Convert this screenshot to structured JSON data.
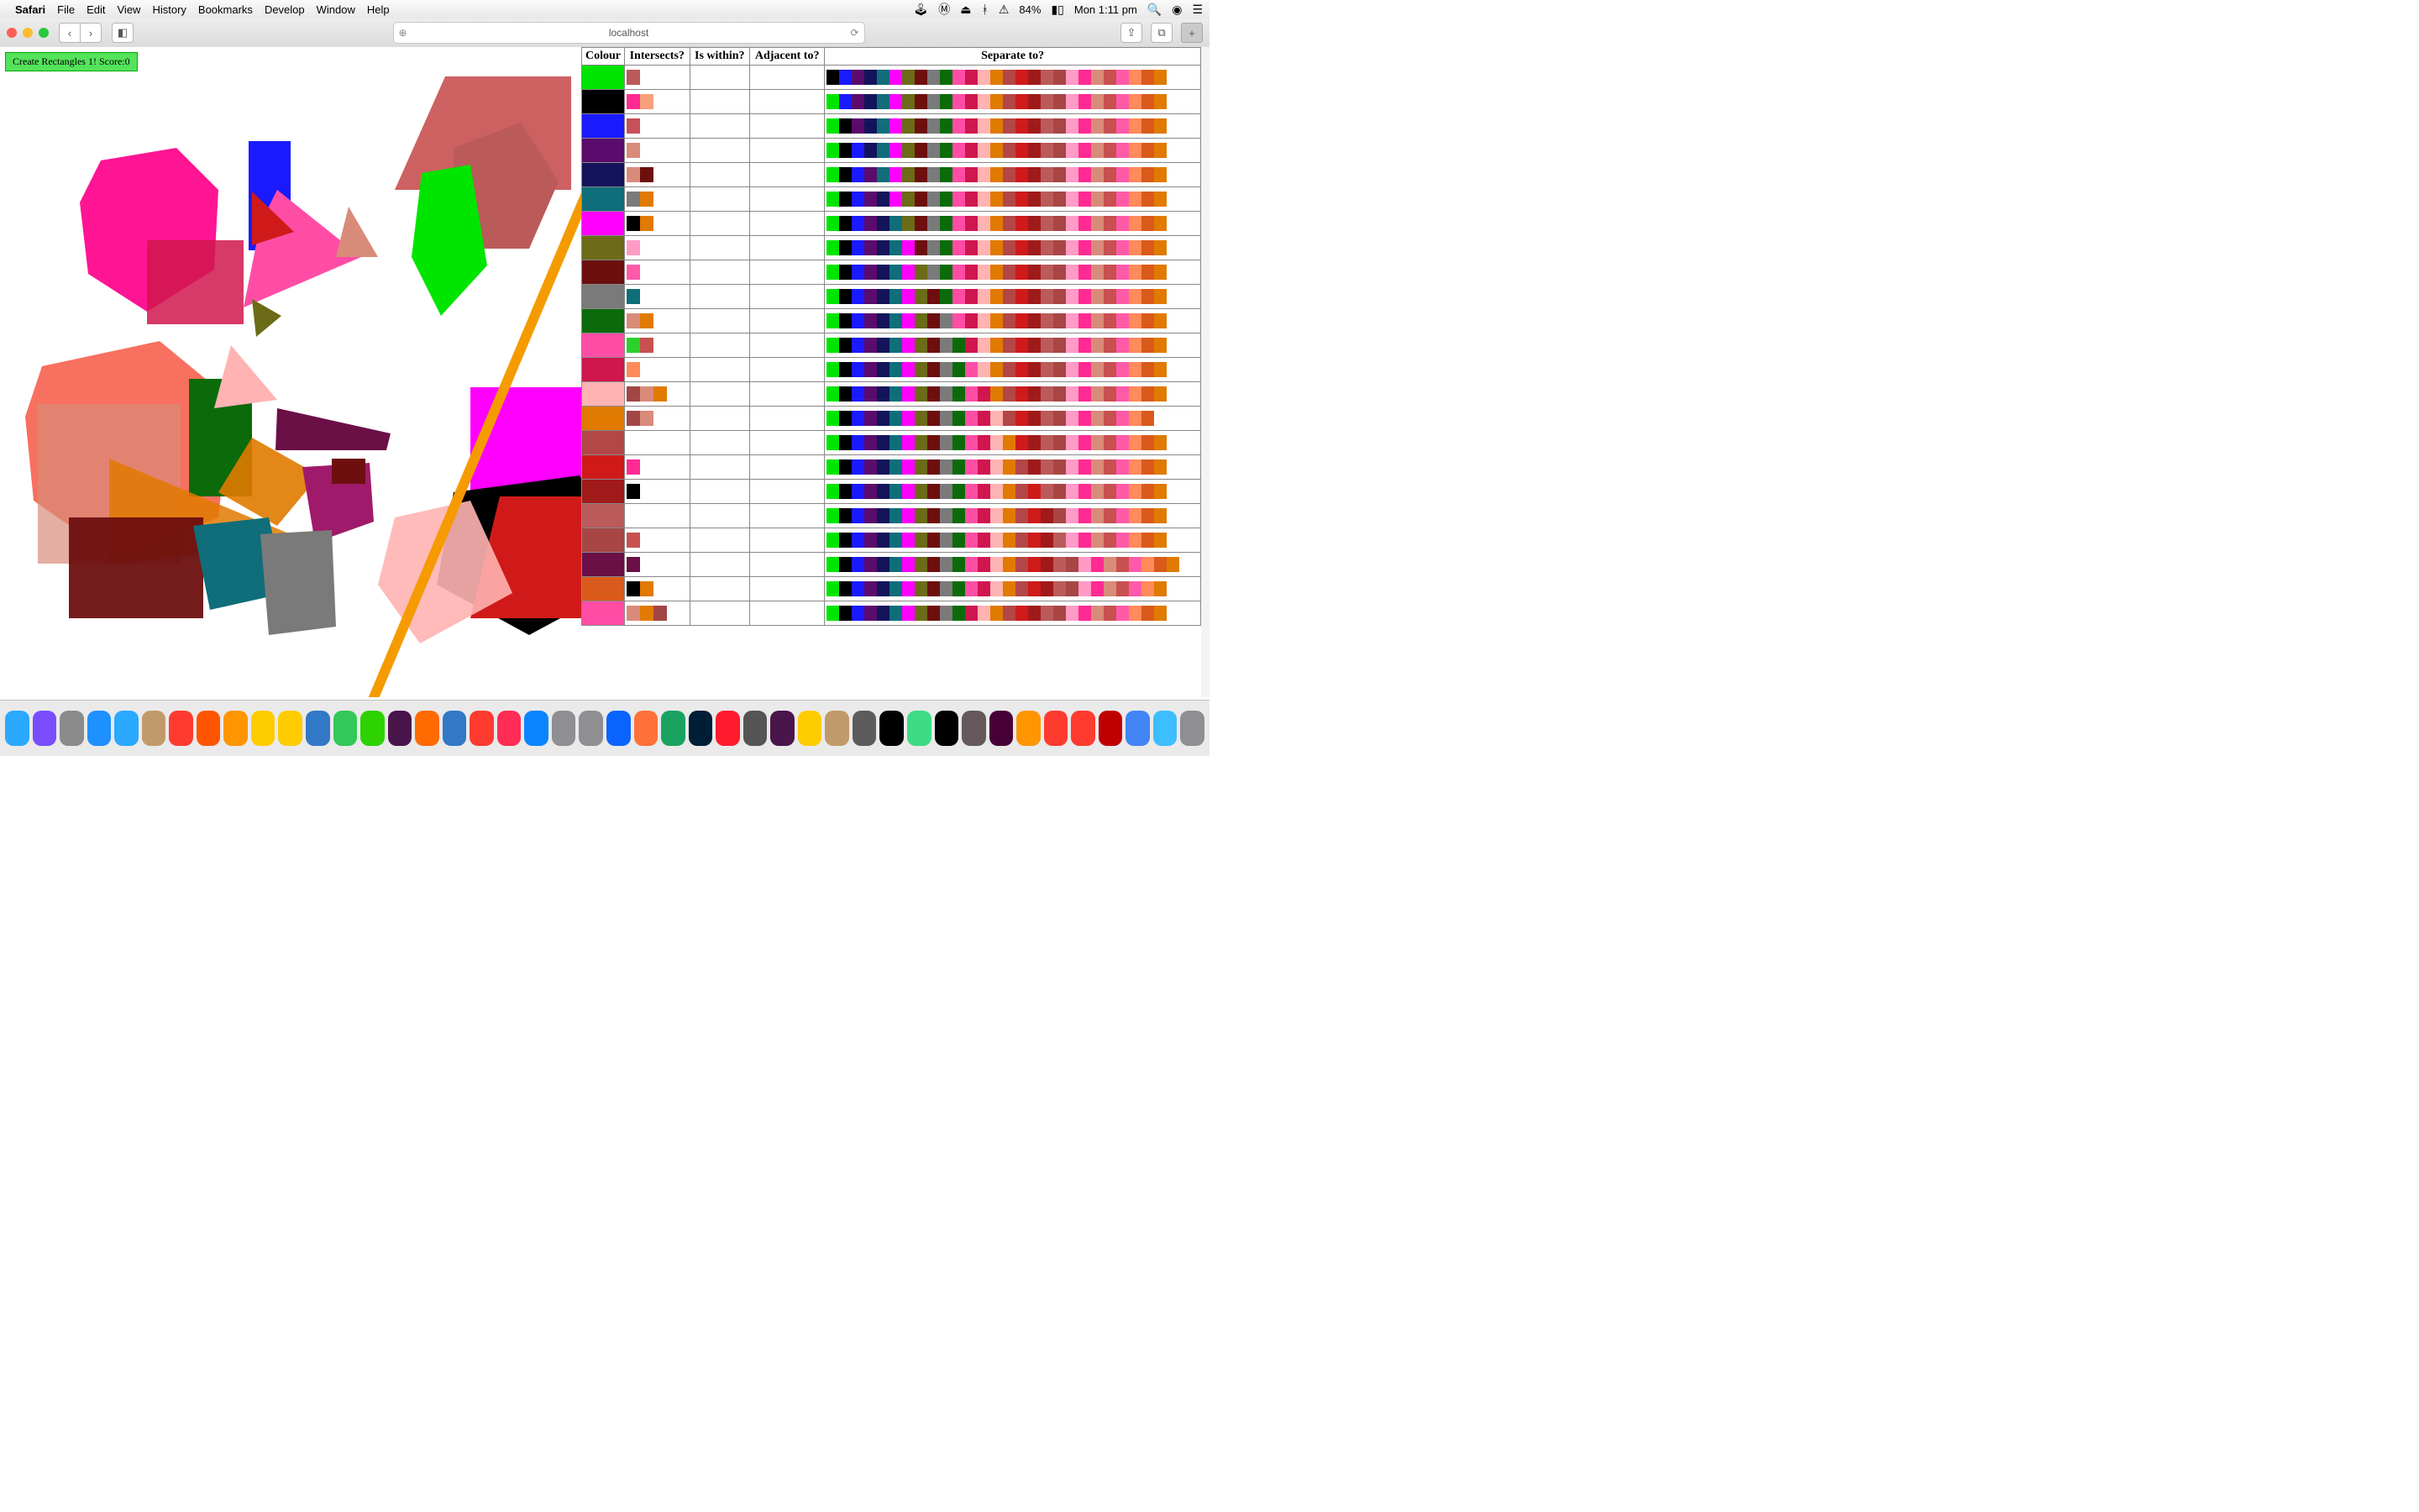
{
  "menubar": {
    "app": "Safari",
    "items": [
      "File",
      "Edit",
      "View",
      "History",
      "Bookmarks",
      "Develop",
      "Window",
      "Help"
    ],
    "battery_pct": "84%",
    "clock": "Mon 1:11 pm"
  },
  "toolbar": {
    "url": "localhost"
  },
  "page": {
    "score_button": "Create Rectangles 1! Score:0",
    "headers": {
      "colour": "Colour",
      "intersects": "Intersects?",
      "within": "Is within?",
      "adjacent": "Adjacent to?",
      "separate": "Separate to?"
    },
    "rows": [
      {
        "colour": "#00e500",
        "intersects": [
          "#bb5a5a"
        ]
      },
      {
        "colour": "#000000",
        "intersects": [
          "#ff2a92",
          "#f7a07a"
        ]
      },
      {
        "colour": "#1a1aff",
        "intersects": [
          "#c8505a"
        ]
      },
      {
        "colour": "#5b0b6b",
        "intersects": [
          "#d98b7a"
        ]
      },
      {
        "colour": "#14145c",
        "intersects": [
          "#d98b7a",
          "#6d0f0f"
        ]
      },
      {
        "colour": "#0f6e7a",
        "intersects": [
          "#7a7a7a",
          "#e07a00"
        ]
      },
      {
        "colour": "#ff00ff",
        "intersects": [
          "#000000",
          "#e07a00"
        ]
      },
      {
        "colour": "#6b6b18",
        "intersects": [
          "#ff9bc5"
        ]
      },
      {
        "colour": "#6d0f0f",
        "intersects": [
          "#ff5aa8"
        ]
      },
      {
        "colour": "#7a7a7a",
        "intersects": [
          "#0f6e7a"
        ]
      },
      {
        "colour": "#0b6b0b",
        "intersects": [
          "#d98b7a",
          "#e07a00"
        ]
      },
      {
        "colour": "#ff4da6",
        "intersects": [
          "#2bd12b",
          "#c85050"
        ]
      },
      {
        "colour": "#d0164e",
        "intersects": [
          "#ff8a5a"
        ]
      },
      {
        "colour": "#ffb3b3",
        "intersects": [
          "#a34545",
          "#d98b7a",
          "#e07a00"
        ]
      },
      {
        "colour": "#e07a00",
        "intersects": [
          "#a34545",
          "#d98b7a"
        ]
      },
      {
        "colour": "#b34747",
        "intersects": []
      },
      {
        "colour": "#d01a1a",
        "intersects": [
          "#ff2a92"
        ]
      },
      {
        "colour": "#a01a1a",
        "intersects": [
          "#000000"
        ]
      },
      {
        "colour": "#bb5a5a",
        "intersects": []
      },
      {
        "colour": "#a84545",
        "intersects": [
          "#c85050"
        ]
      },
      {
        "colour": "#6b0f47",
        "intersects": [
          "#6b0f47"
        ]
      },
      {
        "colour": "#d95a1a",
        "intersects": [
          "#000000",
          "#e07a00"
        ]
      },
      {
        "colour": "#ff4da6",
        "intersects": [
          "#d98b7a",
          "#e07a00",
          "#a34545"
        ]
      }
    ],
    "separate_palette": [
      "#00e500",
      "#000000",
      "#1a1aff",
      "#5b0b6b",
      "#14145c",
      "#0f6e7a",
      "#ff00ff",
      "#6b6b18",
      "#6d0f0f",
      "#7a7a7a",
      "#0b6b0b",
      "#ff4da6",
      "#d0164e",
      "#ffb3b3",
      "#e07a00",
      "#b34747",
      "#d01a1a",
      "#a01a1a",
      "#bb5a5a",
      "#a84545",
      "#ff9bc5",
      "#ff2a92",
      "#d98b7a",
      "#c85050",
      "#ff5aa8",
      "#ff8a5a",
      "#d95a1a",
      "#e07a00"
    ]
  },
  "dock_icons": [
    "finder",
    "siri",
    "launchpad",
    "safari",
    "mail",
    "contacts",
    "calendar",
    "dictionary",
    "reminders",
    "photos",
    "notes",
    "preview",
    "messages",
    "wechat",
    "slack",
    "charts",
    "xcode",
    "no-entry",
    "itunes",
    "appstore",
    "systemprefs",
    "activity",
    "firefox-dev",
    "firefox",
    "chrome",
    "photoshop",
    "opera",
    "bitdefender",
    "slack2",
    "star",
    "palette",
    "gimp",
    "terminal",
    "android",
    "terminal2",
    "atom",
    "xd",
    "clock",
    "tag",
    "square",
    "filezilla",
    "translate",
    "folder",
    "trash"
  ]
}
